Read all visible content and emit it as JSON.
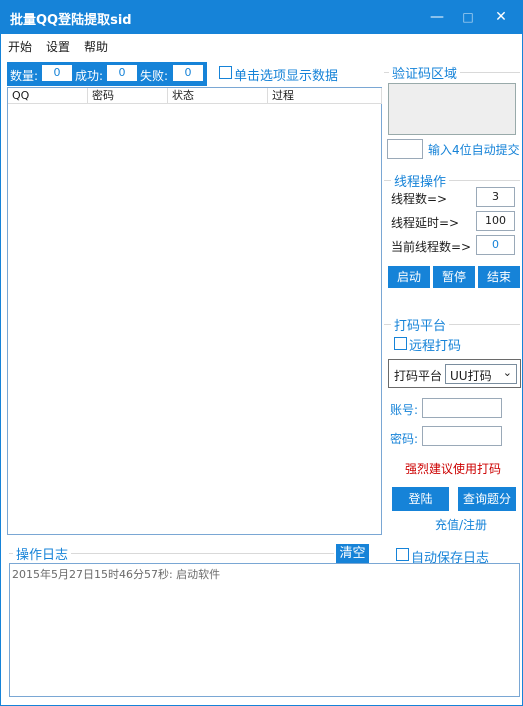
{
  "window": {
    "title": "批量QQ登陆提取sid",
    "minimize_glyph": "—",
    "maximize_glyph": "□",
    "close_glyph": "✕"
  },
  "menu": [
    "开始",
    "设置",
    "帮助"
  ],
  "stats": {
    "count_label": "数量:",
    "count_value": "0",
    "success_label": "成功:",
    "success_value": "0",
    "fail_label": "失败:",
    "fail_value": "0"
  },
  "single_click_checkbox": {
    "label": "单击选项显示数据",
    "checked": false
  },
  "table": {
    "columns": [
      "QQ",
      "密码",
      "状态",
      "过程"
    ],
    "rows": []
  },
  "captcha": {
    "group_title": "验证码区域",
    "auto_submit_label": "输入4位自动提交",
    "input_value": ""
  },
  "thread_ops": {
    "group_title": "线程操作",
    "thread_count_label": "线程数=>",
    "thread_count_value": "3",
    "delay_label": "线程延时=>",
    "delay_value": "100",
    "current_label": "当前线程数=>",
    "current_value": "0",
    "buttons": [
      "启动",
      "暂停",
      "结束"
    ]
  },
  "coding": {
    "group_title": "打码平台",
    "remote_label": "远程打码",
    "remote_checked": false,
    "platform_label": "打码平台",
    "platform_value": "UU打码",
    "account_label": "账号:",
    "password_label": "密码:",
    "warning": "强烈建议使用打码",
    "login_button": "登陆",
    "query_button": "查询题分",
    "recharge_link": "充值/注册"
  },
  "log": {
    "group_title": "操作日志",
    "clear_button": "清空",
    "auto_save_label": "自动保存日志",
    "auto_save_checked": false,
    "lines": [
      "2015年5月27日15时46分57秒: 启动软件"
    ]
  },
  "colors": {
    "accent": "#1683d8",
    "warning": "#cc0000"
  }
}
